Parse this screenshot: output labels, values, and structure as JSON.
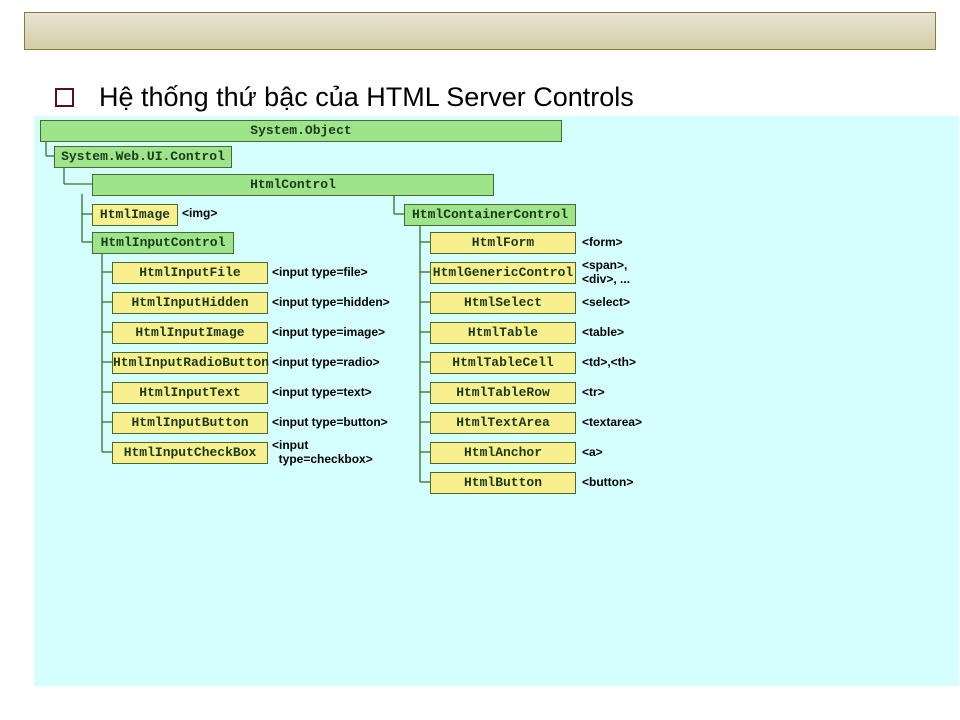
{
  "title": "Hệ thống thứ bậc của HTML Server Controls",
  "root": "System.Object",
  "level1": "System.Web.UI.Control",
  "level2": "HtmlControl",
  "leftA": {
    "name": "HtmlImage",
    "tag": "<img>"
  },
  "leftB": "HtmlInputControl",
  "leftChildren": [
    {
      "name": "HtmlInputFile",
      "tag": "<input type=file>"
    },
    {
      "name": "HtmlInputHidden",
      "tag": "<input type=hidden>"
    },
    {
      "name": "HtmlInputImage",
      "tag": "<input type=image>"
    },
    {
      "name": "HtmlInputRadioButton",
      "tag": "<input type=radio>"
    },
    {
      "name": "HtmlInputText",
      "tag": "<input type=text>"
    },
    {
      "name": "HtmlInputButton",
      "tag": "<input type=button>"
    },
    {
      "name": "HtmlInputCheckBox",
      "tag": "<input\n  type=checkbox>"
    }
  ],
  "rightA": "HtmlContainerControl",
  "rightChildren": [
    {
      "name": "HtmlForm",
      "tag": "<form>"
    },
    {
      "name": "HtmlGenericControl",
      "tag": "<span>,\n<div>, ..."
    },
    {
      "name": "HtmlSelect",
      "tag": "<select>"
    },
    {
      "name": "HtmlTable",
      "tag": "<table>"
    },
    {
      "name": "HtmlTableCell",
      "tag": "<td>,<th>"
    },
    {
      "name": "HtmlTableRow",
      "tag": "<tr>"
    },
    {
      "name": "HtmlTextArea",
      "tag": "<textarea>"
    },
    {
      "name": "HtmlAnchor",
      "tag": "<a>"
    },
    {
      "name": "HtmlButton",
      "tag": "<button>"
    }
  ]
}
